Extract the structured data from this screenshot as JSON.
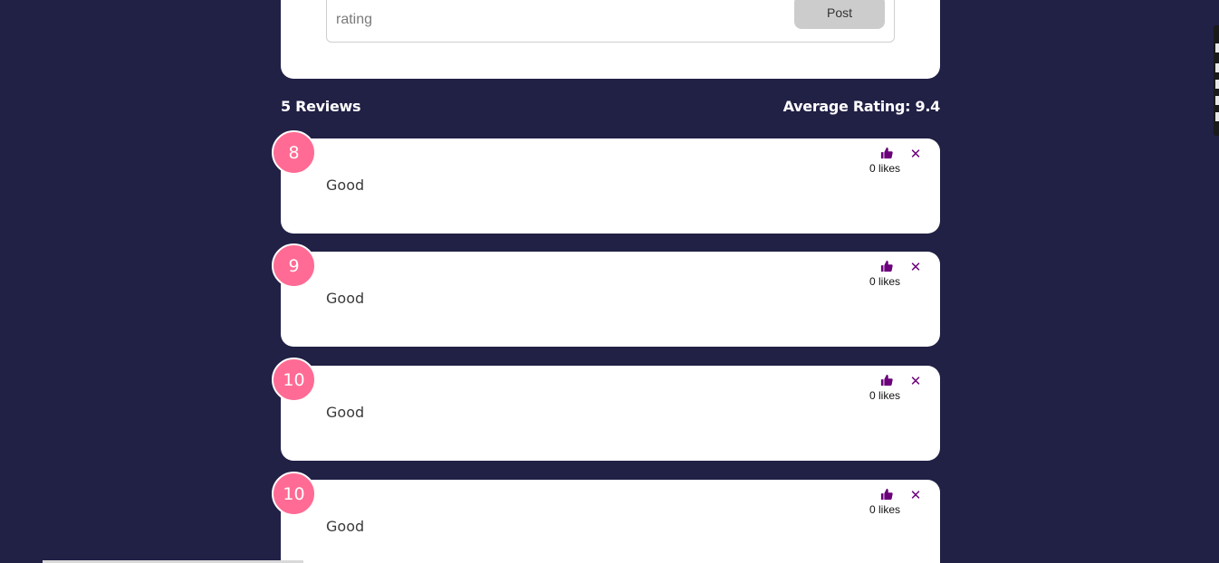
{
  "form": {
    "rating_placeholder": "rating",
    "post_label": "Post"
  },
  "summary": {
    "count_label": "5 Reviews",
    "average_label": "Average Rating: 9.4"
  },
  "reviews": [
    {
      "rating": "8",
      "text": "Good",
      "likes": "0 likes"
    },
    {
      "rating": "9",
      "text": "Good",
      "likes": "0 likes"
    },
    {
      "rating": "10",
      "text": "Good",
      "likes": "0 likes"
    },
    {
      "rating": "10",
      "text": "Good",
      "likes": "0 likes"
    }
  ],
  "colors": {
    "background": "#212045",
    "badge": "#ff6b94",
    "icon": "#6b007a"
  },
  "icons": {
    "like": "thumbs-up-icon",
    "delete": "close-icon"
  }
}
